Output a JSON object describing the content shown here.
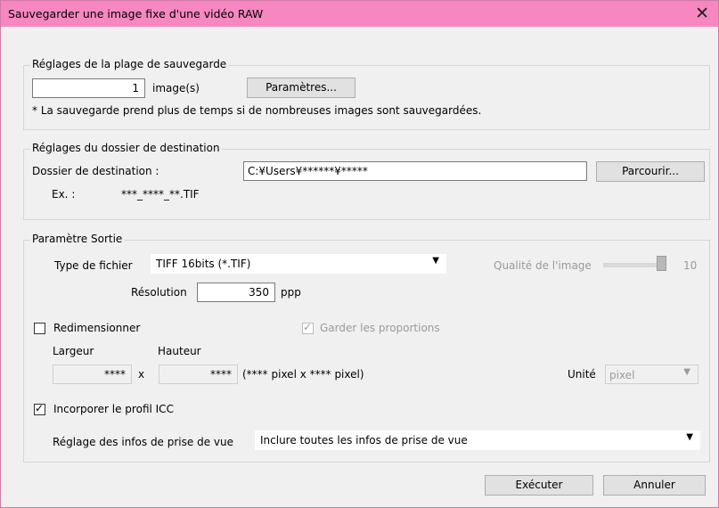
{
  "window": {
    "title": "Sauvegarder une image fixe d'une vidéo RAW"
  },
  "range": {
    "legend": "Réglages de la plage de sauvegarde",
    "image_count": "1",
    "image_unit": "image(s)",
    "params_button": "Paramètres...",
    "note": "* La sauvegarde prend plus de temps si de nombreuses images sont sauvegardées."
  },
  "destination": {
    "legend": "Réglages du dossier de destination",
    "folder_label": "Dossier de destination :",
    "folder_value": "C:¥Users¥******¥*****",
    "browse_button": "Parcourir...",
    "ex_label": "Ex. :",
    "ex_value": "***_****_**.TIF"
  },
  "output": {
    "legend": "Paramètre Sortie",
    "filetype_label": "Type de fichier",
    "filetype_value": "TIFF 16bits (*.TIF)",
    "quality_label": "Qualité de l'image",
    "quality_value": "10",
    "resolution_label": "Résolution",
    "resolution_value": "350",
    "resolution_unit": "ppp",
    "resize_label": "Redimensionner",
    "keep_ratio_label": "Garder les proportions",
    "width_label": "Largeur",
    "height_label": "Hauteur",
    "width_value": "****",
    "times": "x",
    "height_value": "****",
    "pixel_info": "(**** pixel x **** pixel)",
    "unit_label": "Unité",
    "unit_value": "pixel",
    "icc_label": "Incorporer le profil ICC",
    "shooting_info_label": "Réglage des infos de prise de vue",
    "shooting_info_value": "Inclure toutes les infos de prise de vue"
  },
  "footer": {
    "execute_button": "Exécuter",
    "cancel_button": "Annuler"
  }
}
